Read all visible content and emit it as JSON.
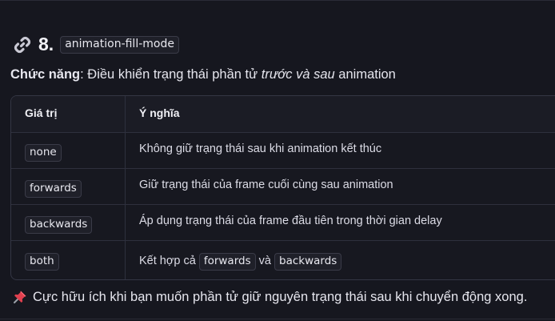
{
  "section": {
    "number": "8.",
    "property": "animation-fill-mode"
  },
  "description": {
    "label": "Chức năng",
    "colon": ":",
    "text_before": " Điều khiển trạng thái phần tử ",
    "emphasis": "trước và sau",
    "text_after": " animation"
  },
  "table": {
    "headers": [
      "Giá trị",
      "Ý nghĩa"
    ],
    "rows": [
      {
        "value": "none",
        "meaning": "Không giữ trạng thái sau khi animation kết thúc"
      },
      {
        "value": "forwards",
        "meaning": "Giữ trạng thái của frame cuối cùng sau animation"
      },
      {
        "value": "backwards",
        "meaning": "Áp dụng trạng thái của frame đầu tiên trong thời gian delay"
      },
      {
        "value": "both",
        "meaning_prefix": "Kết hợp cả",
        "meaning_code1": "forwards",
        "meaning_mid": "và",
        "meaning_code2": "backwards"
      }
    ]
  },
  "tip": {
    "icon": "pushpin-icon",
    "text": "Cực hữu ích khi bạn muốn phần tử giữ nguyên trạng thái sau khi chuyển động xong."
  }
}
